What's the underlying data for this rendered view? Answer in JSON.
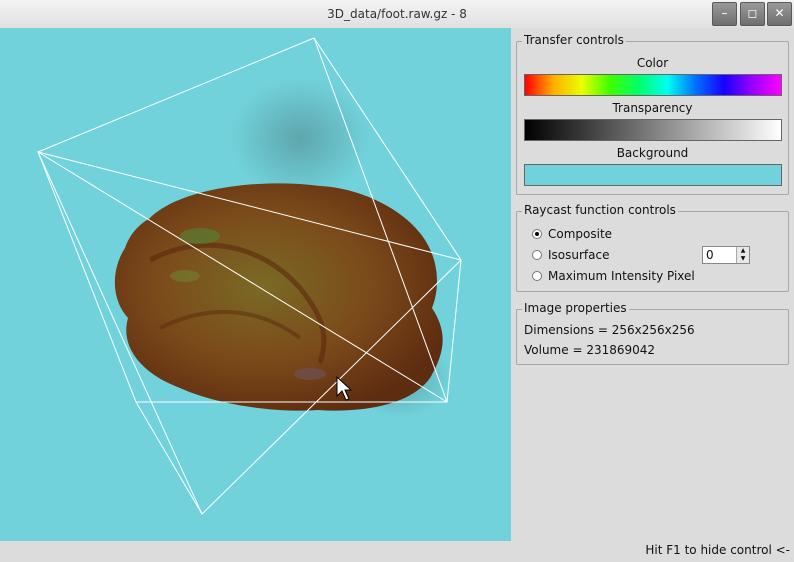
{
  "window": {
    "title": "3D_data/foot.raw.gz - 8",
    "minimize_glyph": "–",
    "maximize_glyph": "◻",
    "close_glyph": "✕"
  },
  "viewport": {
    "background_color": "#71d2db",
    "render_content": "volume-rendered foot with white bounding-box wireframe"
  },
  "transfer_controls": {
    "title": "Transfer controls",
    "color_label": "Color",
    "transparency_label": "Transparency",
    "background_label": "Background",
    "background_swatch_color": "#71d2db"
  },
  "raycast_controls": {
    "title": "Raycast function controls",
    "options": [
      {
        "label": "Composite",
        "selected": true
      },
      {
        "label": "Isosurface",
        "selected": false
      },
      {
        "label": "Maximum Intensity Pixel",
        "selected": false
      }
    ],
    "iso_value": "0"
  },
  "image_properties": {
    "title": "Image properties",
    "dimensions": "Dimensions = 256x256x256",
    "volume": "Volume = 231869042"
  },
  "status": {
    "hint": "Hit F1 to hide control <-"
  }
}
